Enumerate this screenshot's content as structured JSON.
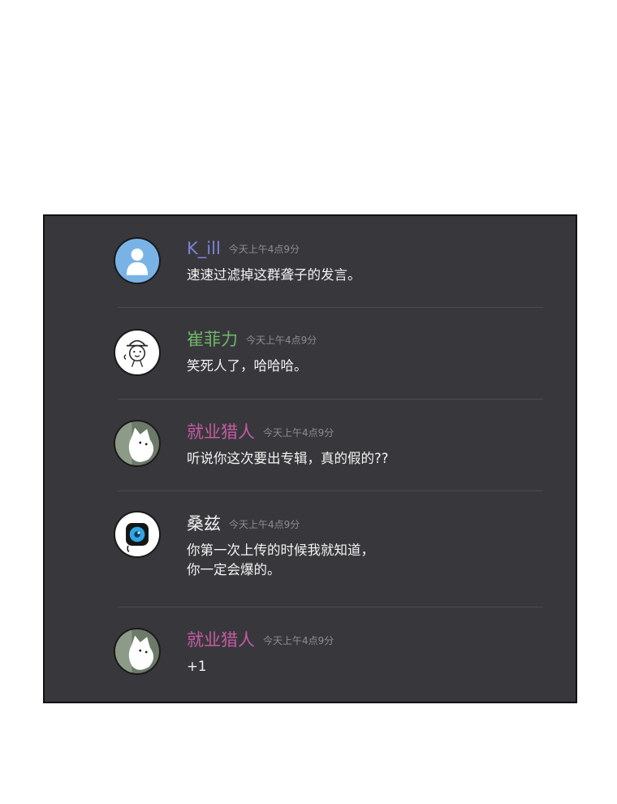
{
  "colors": {
    "panel_background": "#38383c",
    "name_k_ill": "#7c83d8",
    "name_cui": "#6fb56a",
    "name_jiuye": "#c75aa3",
    "name_sangzi": "#f0f0f0",
    "timestamp": "#8d8d92",
    "message_text": "#f3f3f3"
  },
  "messages": [
    {
      "username": "K_ill",
      "timestamp": "今天上午4点9分",
      "text": "速速过滤掉这群聋子的发言。",
      "avatar": "default-user-avatar"
    },
    {
      "username": "崔菲力",
      "timestamp": "今天上午4点9分",
      "text": "笑死人了，哈哈哈。",
      "avatar": "doodle-face-with-hat-avatar"
    },
    {
      "username": "就业猎人",
      "timestamp": "今天上午4点9分",
      "text": "听说你这次要出专辑，真的假的??",
      "avatar": "white-cat-avatar"
    },
    {
      "username": "桑兹",
      "timestamp": "今天上午4点9分",
      "text_line1": "你第一次上传的时候我就知道，",
      "text_line2": "你一定会爆的。",
      "avatar": "blue-eye-avatar"
    },
    {
      "username": "就业猎人",
      "timestamp": "今天上午4点9分",
      "text": "+1",
      "avatar": "white-cat-avatar"
    }
  ]
}
